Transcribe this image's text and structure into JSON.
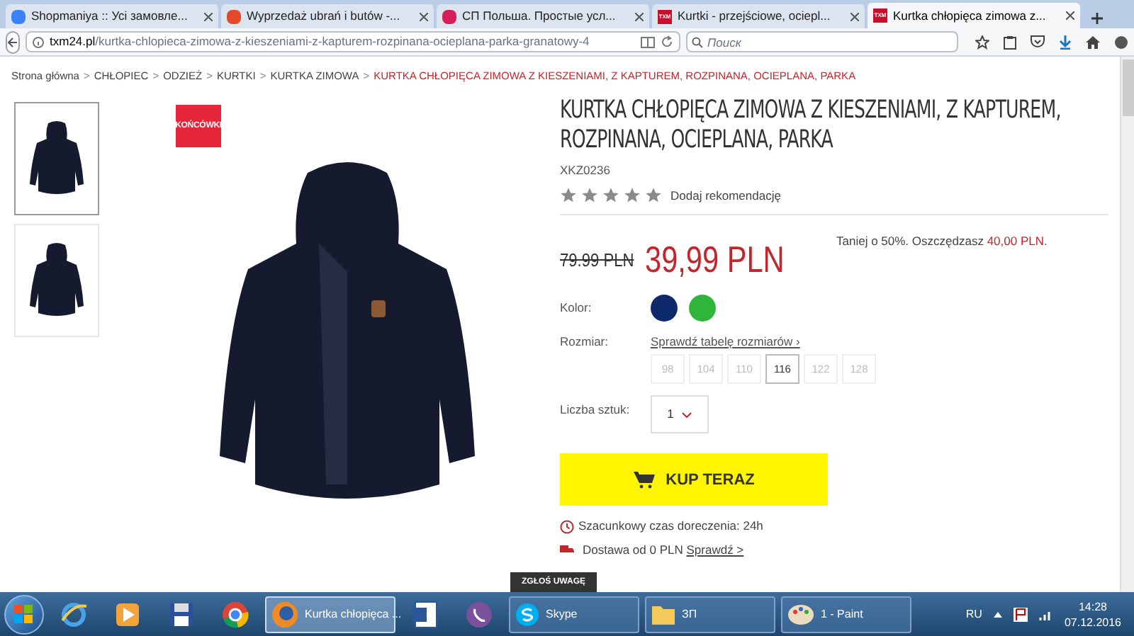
{
  "tabs": [
    {
      "label": "Shopmaniya :: Усі замовле...",
      "selected": false
    },
    {
      "label": "Wyprzedaż ubrań i butów -...",
      "selected": false
    },
    {
      "label": "СП Польша. Простые усл...",
      "selected": false
    },
    {
      "label": "Kurtki - przejściowe, ociepl...",
      "selected": false
    },
    {
      "label": "Kurtka chłopięca zimowa z...",
      "selected": true
    }
  ],
  "tab_icon_text": [
    "TXM",
    "TXM"
  ],
  "address": {
    "domain": "txm24.pl",
    "path": "/kurtka-chlopieca-zimowa-z-kieszeniami-z-kapturem-rozpinana-ocieplana-parka-granatowy-4"
  },
  "search": {
    "placeholder": "Поиск"
  },
  "breadcrumb": [
    {
      "label": "Strona główna",
      "current": false
    },
    {
      "label": "CHŁOPIEC",
      "current": false
    },
    {
      "label": "ODZIEŻ",
      "current": false
    },
    {
      "label": "KURTKI",
      "current": false
    },
    {
      "label": "KURTKA ZIMOWA",
      "current": false
    },
    {
      "label": "KURTKA CHŁOPIĘCA ZIMOWA Z KIESZENIAMI, Z KAPTUREM, ROZPINANA, OCIEPLANA, PARKA",
      "current": true
    }
  ],
  "breadcrumb_separator": ">",
  "thumbnails": [
    {
      "selected": true
    },
    {
      "selected": false
    }
  ],
  "badge": "KOŃCÓWKI",
  "product": {
    "title": "KURTKA CHŁOPIĘCA ZIMOWA Z KIESZENIAMI, Z KAPTUREM, ROZPINANA, OCIEPLANA, PARKA",
    "code": "XKZ0236",
    "recommend": "Dodaj rekomendację",
    "old_price": "79.99 PLN",
    "price": "39,99 PLN",
    "saving": "Taniej o 50%. Oszczędzasz **40,00 PLN.**",
    "color_label": "Kolor:",
    "colors": [
      {
        "color": "#0f2a6b"
      },
      {
        "color": "#2fb53a"
      }
    ],
    "size_label": "Rozmiar:",
    "size_link": "Sprawdź tabelę rozmiarów ›",
    "sizes": [
      {
        "label": "98",
        "selected": false
      },
      {
        "label": "104",
        "selected": false
      },
      {
        "label": "110",
        "selected": false
      },
      {
        "label": "116",
        "selected": true
      },
      {
        "label": "122",
        "selected": false
      },
      {
        "label": "128",
        "selected": false
      }
    ],
    "qty_label": "Liczba sztuk:",
    "qty": "1",
    "buy": "KUP TERAZ",
    "delivery": "Szacunkowy czas doreczenia: 24h",
    "shipping": "Dostawa od 0 PLN",
    "shipping_link": "Sprawdź >"
  },
  "feedback": "ZGŁOŚ UWAGĘ",
  "taskbar": [
    {
      "kind": "icon"
    },
    {
      "kind": "icon"
    },
    {
      "kind": "icon"
    },
    {
      "kind": "icon"
    },
    {
      "kind": "button",
      "label": "Kurtka chłopięca ...",
      "selected": true
    },
    {
      "kind": "icon"
    },
    {
      "kind": "icon"
    },
    {
      "kind": "button",
      "label": "Skype",
      "selected": false
    },
    {
      "kind": "button",
      "label": "ЗП",
      "selected": false
    },
    {
      "kind": "button",
      "label": "1 - Paint",
      "selected": false
    }
  ],
  "tray": {
    "lang": "RU",
    "time": "14:28",
    "date": "07.12.2016"
  }
}
